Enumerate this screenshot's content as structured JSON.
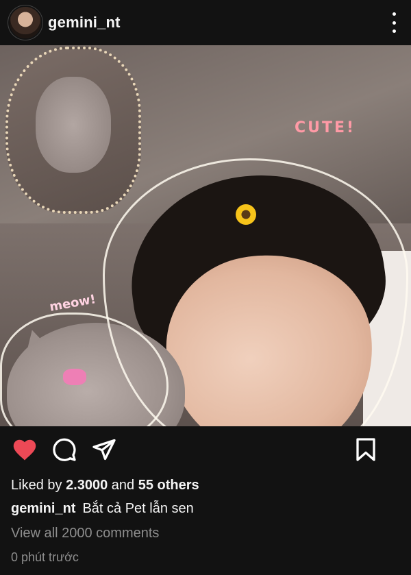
{
  "post": {
    "username": "gemini_nt",
    "photo": {
      "stickers": {
        "cute": "CUTE!",
        "meow": "meow!"
      }
    },
    "likes": {
      "prefix": "Liked by",
      "top_liker": "2.3000",
      "joiner": "and",
      "others": "55 others"
    },
    "caption": {
      "username": "gemini_nt",
      "text": "Bắt cả Pet lẫn sen"
    },
    "comments": {
      "view_all": "View all  2000 comments"
    },
    "timestamp": "0 phút trước"
  },
  "icons": {
    "like": "heart-filled-icon",
    "comment": "comment-bubble-icon",
    "share": "paper-plane-icon",
    "save": "bookmark-icon",
    "more": "more-vertical-icon"
  },
  "colors": {
    "background": "#121212",
    "like_active": "#ed4956",
    "muted": "#8e8e8e"
  }
}
